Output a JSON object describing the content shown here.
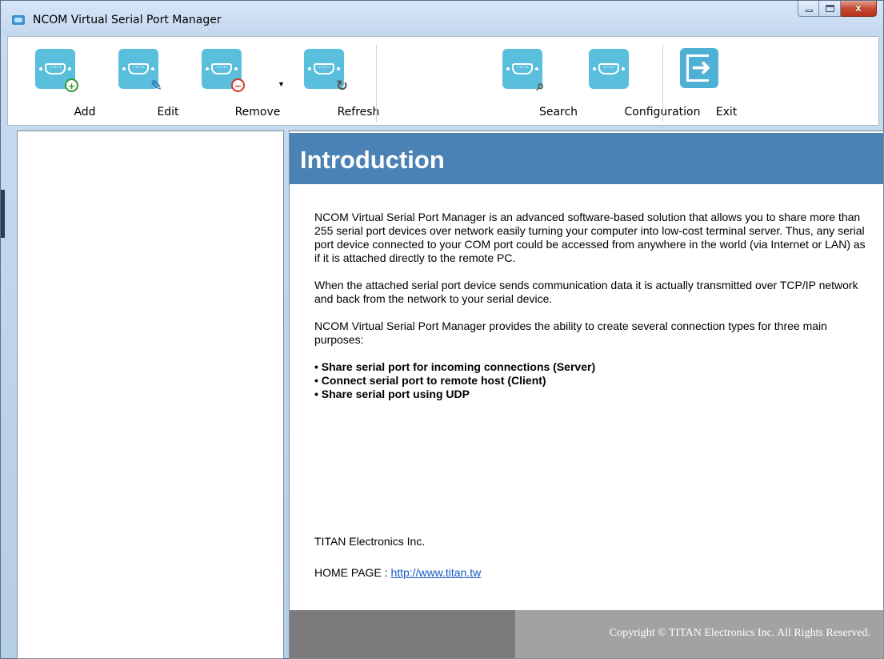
{
  "window": {
    "title": "NCOM Virtual Serial Port Manager",
    "close_glyph": "x"
  },
  "toolbar": {
    "add_label": "Add",
    "edit_label": "Edit",
    "remove_label": "Remove",
    "refresh_label": "Refresh",
    "search_label": "Search",
    "configuration_label": "Configuration",
    "exit_label": "Exit",
    "dropdown_glyph": "▼"
  },
  "intro": {
    "title": "Introduction",
    "paragraphs": [
      "NCOM Virtual Serial Port Manager is an advanced software-based solution that allows you to share more than 255 serial port devices over network easily turning your computer into low-cost terminal server. Thus, any serial port device connected to your COM port could be accessed from anywhere in the world (via Internet or LAN) as if it is attached directly to the remote PC.",
      "When the attached serial port device sends communication data it is actually transmitted over TCP/IP network and back from the network to your serial device.",
      "NCOM Virtual Serial Port Manager provides the ability to create several connection types for three main purposes:"
    ],
    "bullets": [
      "Share serial port for incoming connections (Server)",
      "Connect serial port to remote host (Client)",
      "Share serial port using UDP"
    ],
    "company": "TITAN Electronics Inc.",
    "homepage_label": "HOME PAGE : ",
    "homepage_url": "http://www.titan.tw"
  },
  "footer": {
    "copyright": "Copyright © TITAN Electronics Inc. All Rights Reserved."
  },
  "icons": {
    "app": "serial-port-icon",
    "add": "serial-port-add-icon",
    "edit": "serial-port-edit-icon",
    "remove": "serial-port-remove-icon",
    "refresh": "serial-port-refresh-icon",
    "search": "serial-port-search-icon",
    "configuration": "serial-port-config-icon",
    "exit": "exit-icon"
  },
  "colors": {
    "icon_teal": "#5abfdc",
    "header_blue": "#4b82b5",
    "footer_dark": "#7b7b7b",
    "footer_light": "#a2a2a2",
    "link": "#1a5bc4"
  }
}
